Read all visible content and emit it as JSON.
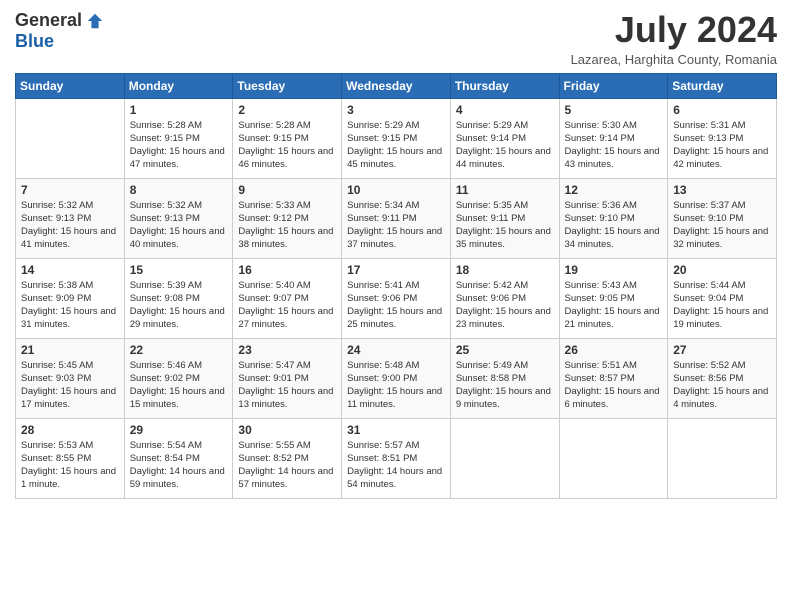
{
  "header": {
    "logo_general": "General",
    "logo_blue": "Blue",
    "title": "July 2024",
    "subtitle": "Lazarea, Harghita County, Romania"
  },
  "days_of_week": [
    "Sunday",
    "Monday",
    "Tuesday",
    "Wednesday",
    "Thursday",
    "Friday",
    "Saturday"
  ],
  "weeks": [
    [
      {
        "day": "",
        "sunrise": "",
        "sunset": "",
        "daylight": ""
      },
      {
        "day": "1",
        "sunrise": "Sunrise: 5:28 AM",
        "sunset": "Sunset: 9:15 PM",
        "daylight": "Daylight: 15 hours and 47 minutes."
      },
      {
        "day": "2",
        "sunrise": "Sunrise: 5:28 AM",
        "sunset": "Sunset: 9:15 PM",
        "daylight": "Daylight: 15 hours and 46 minutes."
      },
      {
        "day": "3",
        "sunrise": "Sunrise: 5:29 AM",
        "sunset": "Sunset: 9:15 PM",
        "daylight": "Daylight: 15 hours and 45 minutes."
      },
      {
        "day": "4",
        "sunrise": "Sunrise: 5:29 AM",
        "sunset": "Sunset: 9:14 PM",
        "daylight": "Daylight: 15 hours and 44 minutes."
      },
      {
        "day": "5",
        "sunrise": "Sunrise: 5:30 AM",
        "sunset": "Sunset: 9:14 PM",
        "daylight": "Daylight: 15 hours and 43 minutes."
      },
      {
        "day": "6",
        "sunrise": "Sunrise: 5:31 AM",
        "sunset": "Sunset: 9:13 PM",
        "daylight": "Daylight: 15 hours and 42 minutes."
      }
    ],
    [
      {
        "day": "7",
        "sunrise": "Sunrise: 5:32 AM",
        "sunset": "Sunset: 9:13 PM",
        "daylight": "Daylight: 15 hours and 41 minutes."
      },
      {
        "day": "8",
        "sunrise": "Sunrise: 5:32 AM",
        "sunset": "Sunset: 9:13 PM",
        "daylight": "Daylight: 15 hours and 40 minutes."
      },
      {
        "day": "9",
        "sunrise": "Sunrise: 5:33 AM",
        "sunset": "Sunset: 9:12 PM",
        "daylight": "Daylight: 15 hours and 38 minutes."
      },
      {
        "day": "10",
        "sunrise": "Sunrise: 5:34 AM",
        "sunset": "Sunset: 9:11 PM",
        "daylight": "Daylight: 15 hours and 37 minutes."
      },
      {
        "day": "11",
        "sunrise": "Sunrise: 5:35 AM",
        "sunset": "Sunset: 9:11 PM",
        "daylight": "Daylight: 15 hours and 35 minutes."
      },
      {
        "day": "12",
        "sunrise": "Sunrise: 5:36 AM",
        "sunset": "Sunset: 9:10 PM",
        "daylight": "Daylight: 15 hours and 34 minutes."
      },
      {
        "day": "13",
        "sunrise": "Sunrise: 5:37 AM",
        "sunset": "Sunset: 9:10 PM",
        "daylight": "Daylight: 15 hours and 32 minutes."
      }
    ],
    [
      {
        "day": "14",
        "sunrise": "Sunrise: 5:38 AM",
        "sunset": "Sunset: 9:09 PM",
        "daylight": "Daylight: 15 hours and 31 minutes."
      },
      {
        "day": "15",
        "sunrise": "Sunrise: 5:39 AM",
        "sunset": "Sunset: 9:08 PM",
        "daylight": "Daylight: 15 hours and 29 minutes."
      },
      {
        "day": "16",
        "sunrise": "Sunrise: 5:40 AM",
        "sunset": "Sunset: 9:07 PM",
        "daylight": "Daylight: 15 hours and 27 minutes."
      },
      {
        "day": "17",
        "sunrise": "Sunrise: 5:41 AM",
        "sunset": "Sunset: 9:06 PM",
        "daylight": "Daylight: 15 hours and 25 minutes."
      },
      {
        "day": "18",
        "sunrise": "Sunrise: 5:42 AM",
        "sunset": "Sunset: 9:06 PM",
        "daylight": "Daylight: 15 hours and 23 minutes."
      },
      {
        "day": "19",
        "sunrise": "Sunrise: 5:43 AM",
        "sunset": "Sunset: 9:05 PM",
        "daylight": "Daylight: 15 hours and 21 minutes."
      },
      {
        "day": "20",
        "sunrise": "Sunrise: 5:44 AM",
        "sunset": "Sunset: 9:04 PM",
        "daylight": "Daylight: 15 hours and 19 minutes."
      }
    ],
    [
      {
        "day": "21",
        "sunrise": "Sunrise: 5:45 AM",
        "sunset": "Sunset: 9:03 PM",
        "daylight": "Daylight: 15 hours and 17 minutes."
      },
      {
        "day": "22",
        "sunrise": "Sunrise: 5:46 AM",
        "sunset": "Sunset: 9:02 PM",
        "daylight": "Daylight: 15 hours and 15 minutes."
      },
      {
        "day": "23",
        "sunrise": "Sunrise: 5:47 AM",
        "sunset": "Sunset: 9:01 PM",
        "daylight": "Daylight: 15 hours and 13 minutes."
      },
      {
        "day": "24",
        "sunrise": "Sunrise: 5:48 AM",
        "sunset": "Sunset: 9:00 PM",
        "daylight": "Daylight: 15 hours and 11 minutes."
      },
      {
        "day": "25",
        "sunrise": "Sunrise: 5:49 AM",
        "sunset": "Sunset: 8:58 PM",
        "daylight": "Daylight: 15 hours and 9 minutes."
      },
      {
        "day": "26",
        "sunrise": "Sunrise: 5:51 AM",
        "sunset": "Sunset: 8:57 PM",
        "daylight": "Daylight: 15 hours and 6 minutes."
      },
      {
        "day": "27",
        "sunrise": "Sunrise: 5:52 AM",
        "sunset": "Sunset: 8:56 PM",
        "daylight": "Daylight: 15 hours and 4 minutes."
      }
    ],
    [
      {
        "day": "28",
        "sunrise": "Sunrise: 5:53 AM",
        "sunset": "Sunset: 8:55 PM",
        "daylight": "Daylight: 15 hours and 1 minute."
      },
      {
        "day": "29",
        "sunrise": "Sunrise: 5:54 AM",
        "sunset": "Sunset: 8:54 PM",
        "daylight": "Daylight: 14 hours and 59 minutes."
      },
      {
        "day": "30",
        "sunrise": "Sunrise: 5:55 AM",
        "sunset": "Sunset: 8:52 PM",
        "daylight": "Daylight: 14 hours and 57 minutes."
      },
      {
        "day": "31",
        "sunrise": "Sunrise: 5:57 AM",
        "sunset": "Sunset: 8:51 PM",
        "daylight": "Daylight: 14 hours and 54 minutes."
      },
      {
        "day": "",
        "sunrise": "",
        "sunset": "",
        "daylight": ""
      },
      {
        "day": "",
        "sunrise": "",
        "sunset": "",
        "daylight": ""
      },
      {
        "day": "",
        "sunrise": "",
        "sunset": "",
        "daylight": ""
      }
    ]
  ]
}
